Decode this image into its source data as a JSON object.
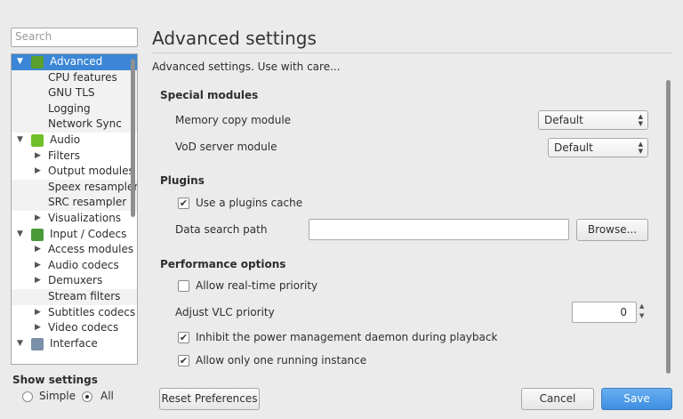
{
  "search": {
    "placeholder": "Search"
  },
  "tree": [
    {
      "label": "Advanced",
      "level": 0,
      "expanded": true,
      "icon": "advanced-chip-icon",
      "selected": true
    },
    {
      "label": "CPU features",
      "level": 1
    },
    {
      "label": "GNU TLS",
      "level": 1
    },
    {
      "label": "Logging",
      "level": 1
    },
    {
      "label": "Network Sync",
      "level": 1
    },
    {
      "label": "Audio",
      "level": 0,
      "expanded": true,
      "icon": "audio-note-icon"
    },
    {
      "label": "Filters",
      "level": 1,
      "collapsed": true
    },
    {
      "label": "Output modules",
      "level": 1,
      "collapsed": true
    },
    {
      "label": "Speex resampler",
      "level": 1
    },
    {
      "label": "SRC resampler",
      "level": 1
    },
    {
      "label": "Visualizations",
      "level": 1,
      "collapsed": true
    },
    {
      "label": "Input / Codecs",
      "level": 0,
      "expanded": true,
      "icon": "input-codecs-icon"
    },
    {
      "label": "Access modules",
      "level": 1,
      "collapsed": true
    },
    {
      "label": "Audio codecs",
      "level": 1,
      "collapsed": true
    },
    {
      "label": "Demuxers",
      "level": 1,
      "collapsed": true
    },
    {
      "label": "Stream filters",
      "level": 1
    },
    {
      "label": "Subtitles codecs",
      "level": 1,
      "collapsed": true
    },
    {
      "label": "Video codecs",
      "level": 1,
      "collapsed": true
    },
    {
      "label": "Interface",
      "level": 0,
      "expanded": true,
      "icon": "interface-icon"
    }
  ],
  "show_settings": {
    "title": "Show settings",
    "options": [
      "Simple",
      "All"
    ],
    "selected": "All"
  },
  "main": {
    "title": "Advanced settings",
    "subtitle": "Advanced settings. Use with care...",
    "special_modules": {
      "heading": "Special modules",
      "memory_copy_label": "Memory copy module",
      "memory_copy_value": "Default",
      "vod_label": "VoD server module",
      "vod_value": "Default"
    },
    "plugins": {
      "heading": "Plugins",
      "use_cache_label": "Use a plugins cache",
      "use_cache_checked": true,
      "data_path_label": "Data search path",
      "data_path_value": "",
      "browse_label": "Browse..."
    },
    "performance": {
      "heading": "Performance options",
      "realtime_label": "Allow real-time priority",
      "realtime_checked": false,
      "priority_label": "Adjust VLC priority",
      "priority_value": "0",
      "inhibit_label": "Inhibit the power management daemon during playback",
      "inhibit_checked": true,
      "one_instance_label": "Allow only one running instance",
      "one_instance_checked": true
    }
  },
  "buttons": {
    "reset": "Reset Preferences",
    "cancel": "Cancel",
    "save": "Save"
  },
  "colors": {
    "selection": "#3b86d6",
    "save_button": "#4a97e6"
  }
}
